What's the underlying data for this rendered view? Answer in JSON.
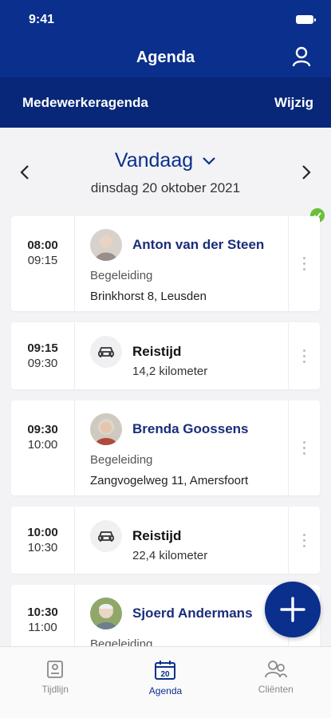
{
  "status_bar": {
    "time": "9:41"
  },
  "header": {
    "title": "Agenda",
    "subtitle": "Medewerkeragenda",
    "edit_label": "Wijzig"
  },
  "date_nav": {
    "day_label": "Vandaag",
    "date": "dinsdag 20 oktober 2021"
  },
  "appointments": [
    {
      "start": "08:00",
      "end": "09:15",
      "name": "Anton van der Steen",
      "activity": "Begeleiding",
      "address": "Brinkhorst 8, Leusden"
    },
    {
      "start": "09:15",
      "end": "09:30",
      "label": "Reistijd",
      "distance": "14,2 kilometer"
    },
    {
      "start": "09:30",
      "end": "10:00",
      "name": "Brenda Goossens",
      "activity": "Begeleiding",
      "address": "Zangvogelweg 11, Amersfoort"
    },
    {
      "start": "10:00",
      "end": "10:30",
      "label": "Reistijd",
      "distance": "22,4 kilometer"
    },
    {
      "start": "10:30",
      "end": "11:00",
      "name": "Sjoerd Andermans",
      "activity": "Begeleiding"
    }
  ],
  "tabs": [
    {
      "label": "Tijdlijn",
      "icon": "timeline-icon"
    },
    {
      "label": "Agenda",
      "icon": "calendar-icon",
      "badge": "20"
    },
    {
      "label": "Cliënten",
      "icon": "clients-icon"
    }
  ],
  "colors": {
    "primary": "#0a2f8c",
    "done": "#6bbf3b"
  }
}
